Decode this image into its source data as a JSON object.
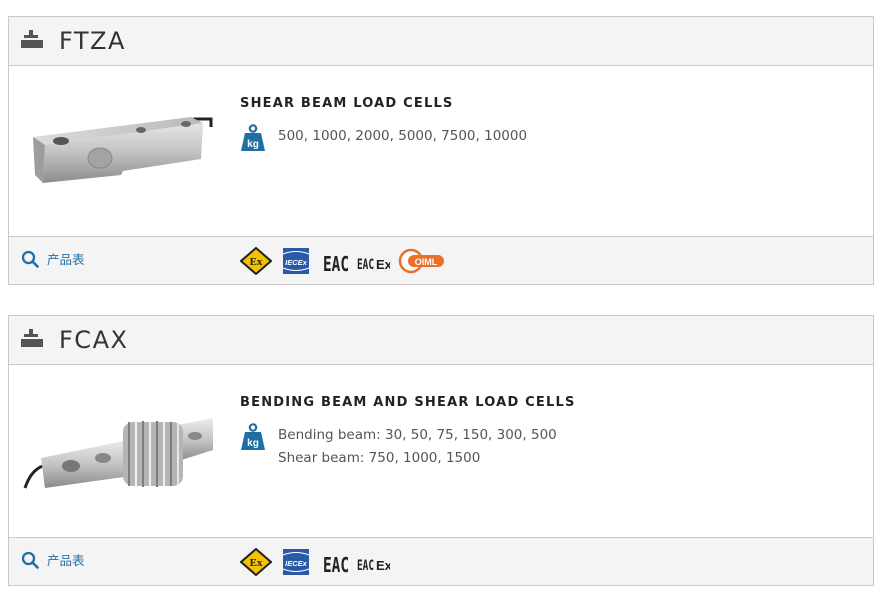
{
  "products": [
    {
      "name": "FTZA",
      "category": "SHEAR BEAM LOAD CELLS",
      "capacity_icon": "kg-weight-icon",
      "capacity_lines": [
        "500, 1000, 2000, 5000, 7500, 10000"
      ],
      "datasheet_label": "产品表",
      "certifications": [
        "ATEX",
        "IECEx",
        "EAC",
        "EAC Ex",
        "OIML"
      ]
    },
    {
      "name": "FCAX",
      "category": "BENDING BEAM AND SHEAR LOAD CELLS",
      "capacity_icon": "kg-weight-icon",
      "capacity_lines": [
        "Bending beam: 30, 50, 75, 150, 300, 500",
        "Shear beam: 750, 1000, 1500"
      ],
      "datasheet_label": "产品表",
      "certifications": [
        "ATEX",
        "IECEx",
        "EAC",
        "EAC Ex"
      ]
    }
  ],
  "cert_marks": {
    "atex": "Ex",
    "iecex": "IECEx",
    "eac": "EAC",
    "eac_ex_prefix": "EAC",
    "eac_ex_suffix": "Ex",
    "oiml": "OIML"
  },
  "weight_unit": "kg",
  "colors": {
    "accent_blue": "#1f6fa3",
    "atex_yellow": "#f3c300",
    "oiml_orange": "#e8702a"
  }
}
